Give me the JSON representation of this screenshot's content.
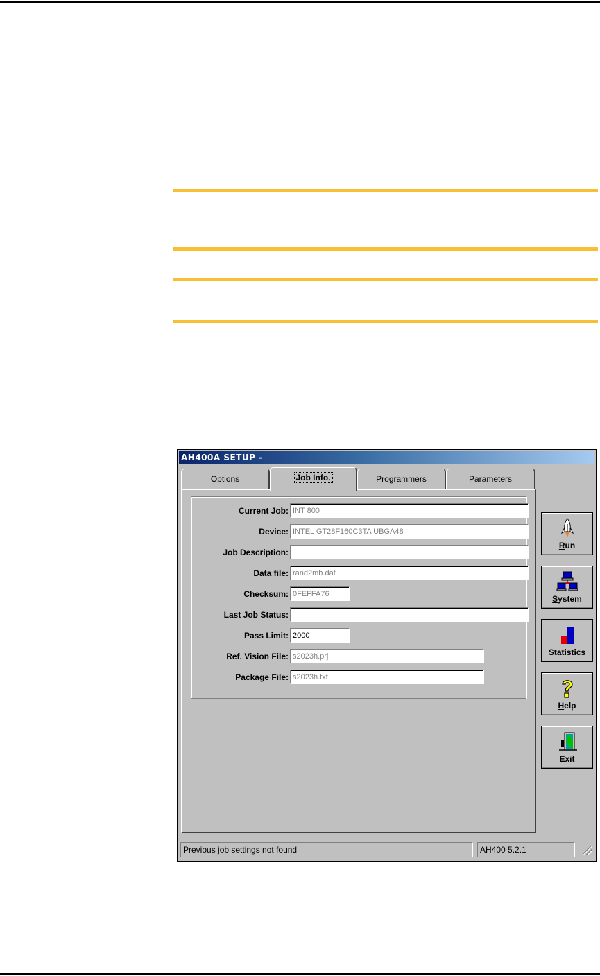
{
  "window": {
    "title": "AH400A  SETUP  -"
  },
  "tabs": [
    {
      "label": "Options",
      "active": false
    },
    {
      "label": "Job Info.",
      "active": true
    },
    {
      "label": "Programmers",
      "active": false
    },
    {
      "label": "Parameters",
      "active": false
    }
  ],
  "form": {
    "current_job": {
      "label": "Current Job:",
      "value": "INT 800"
    },
    "device": {
      "label": "Device:",
      "value": "INTEL GT28F160C3TA UBGA48"
    },
    "job_description": {
      "label": "Job Description:",
      "value": ""
    },
    "data_file": {
      "label": "Data file:",
      "value": "rand2mb.dat"
    },
    "checksum": {
      "label": "Checksum:",
      "value": "0FEFFA76"
    },
    "last_job_status": {
      "label": "Last Job Status:",
      "value": ""
    },
    "pass_limit": {
      "label": "Pass Limit:",
      "value": "2000"
    },
    "ref_vision_file": {
      "label": "Ref. Vision File:",
      "value": "s2023h.prj"
    },
    "package_file": {
      "label": "Package File:",
      "value": "s2023h.txt"
    }
  },
  "side_buttons": {
    "run": {
      "prefix": "",
      "accel": "R",
      "rest": "un",
      "icon": "rocket-icon"
    },
    "system": {
      "prefix": "",
      "accel": "S",
      "rest": "ystem",
      "icon": "network-icon"
    },
    "statistics": {
      "prefix": "",
      "accel": "S",
      "rest": "tatistics",
      "icon": "bar-chart-icon"
    },
    "help": {
      "prefix": "",
      "accel": "H",
      "rest": "elp",
      "icon": "question-mark-icon"
    },
    "exit": {
      "prefix": "E",
      "accel": "x",
      "rest": "it",
      "icon": "exit-door-icon"
    }
  },
  "status_bar": {
    "message": "Previous job settings not found",
    "version": "AH400 5.2.1"
  },
  "colors": {
    "rule_gold": "#f6bf34",
    "title_bar": "#0a246a",
    "face": "#c0c0c0"
  }
}
